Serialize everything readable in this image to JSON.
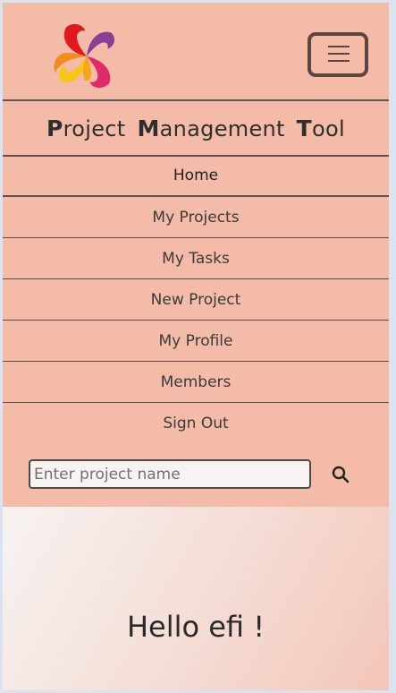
{
  "brand": {
    "title_parts": [
      {
        "cap": "P",
        "rest": "roject"
      },
      {
        "cap": "M",
        "rest": "anagement"
      },
      {
        "cap": "T",
        "rest": "ool"
      }
    ],
    "logo_icon": "swirl-logo-icon"
  },
  "nav": {
    "toggler_icon": "hamburger-icon",
    "items": [
      {
        "label": "Home",
        "active": true
      },
      {
        "label": "My Projects"
      },
      {
        "label": "My Tasks"
      },
      {
        "label": "New Project"
      },
      {
        "label": "My Profile"
      },
      {
        "label": "Members"
      },
      {
        "label": "Sign Out"
      }
    ]
  },
  "search": {
    "placeholder": "Enter project name",
    "value": "",
    "button_icon": "search-icon"
  },
  "main": {
    "greeting": "Hello efi !"
  },
  "colors": {
    "navbar_bg": "#f4bca8",
    "text": "#2e2e2e",
    "border": "#5a4f4c"
  }
}
